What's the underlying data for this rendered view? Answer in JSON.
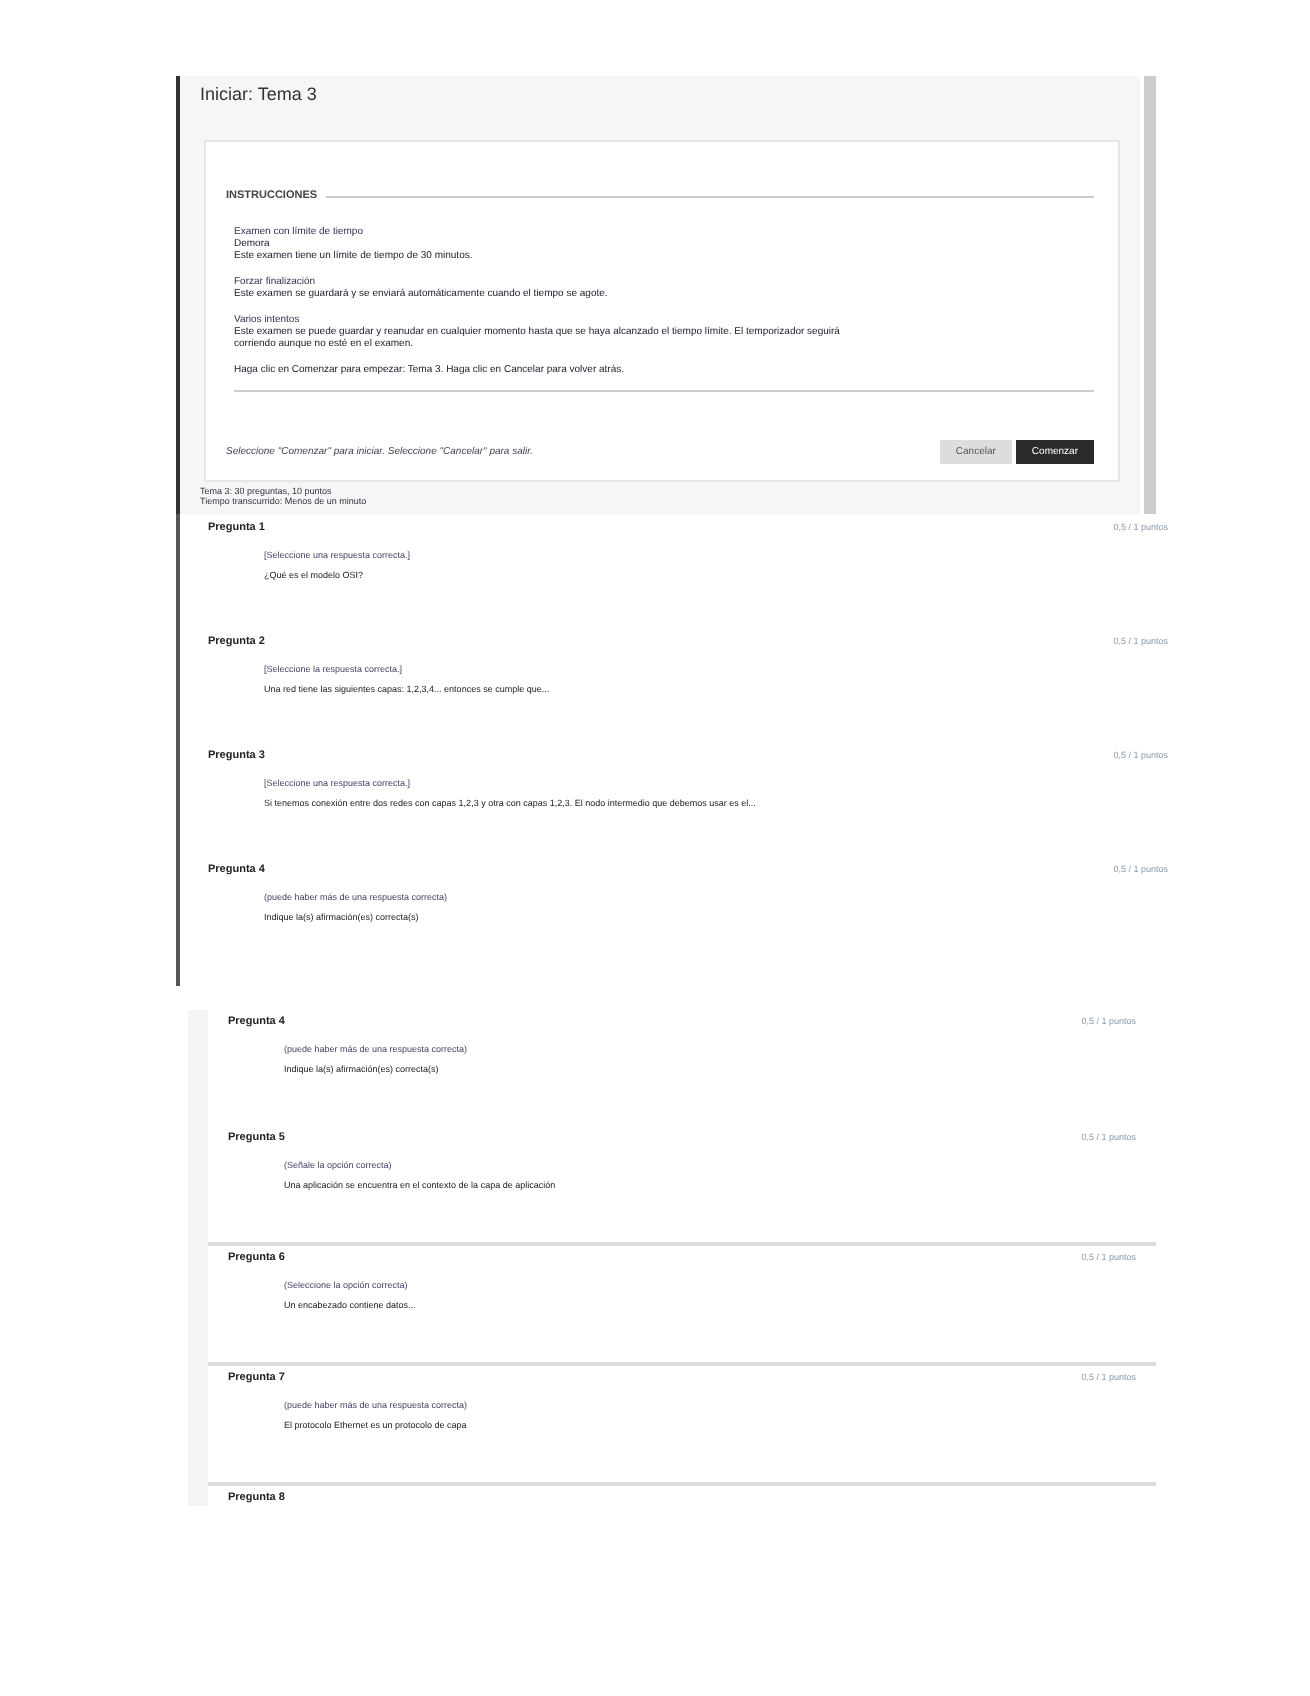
{
  "exam": {
    "title": "Iniciar: Tema 3",
    "section": "INSTRUCCIONES",
    "instructions": [
      {
        "heading": "Examen con límite de tiempo",
        "lines": [
          "Demora",
          "Este examen tiene un límite de tiempo de 30 minutos."
        ]
      },
      {
        "heading": "Forzar finalización",
        "lines": [
          "Este examen se guardará y se enviará automáticamente cuando el tiempo se agote."
        ]
      },
      {
        "heading": "Varios intentos",
        "lines": [
          "Este examen se puede guardar y reanudar en cualquier momento hasta que se haya alcanzado el tiempo límite. El temporizador seguirá",
          "corriendo aunque no esté en el examen."
        ]
      },
      {
        "lines": [
          "Haga clic en Comenzar para empezar: Tema 3. Haga clic en Cancelar para volver atrás."
        ]
      }
    ],
    "footer": "Seleccione \"Comenzar\" para iniciar. Seleccione \"Cancelar\" para salir.",
    "buttons": [
      {
        "label": "Cancelar",
        "kind": "secondary"
      },
      {
        "label": "Comenzar",
        "kind": "primary"
      }
    ],
    "status": [
      "Tema 3: 30 preguntas, 10 puntos",
      "Tiempo transcurrido: Menos de un minuto"
    ]
  },
  "questions": [
    {
      "title": "Pregunta 1",
      "points": "0,5 / 1 puntos",
      "hint": "[Seleccione una respuesta correcta.]",
      "text": "¿Qué es el modelo OSI?"
    },
    {
      "title": "Pregunta 2",
      "points": "0,5 / 1 puntos",
      "hint": "[Seleccione la respuesta correcta.]",
      "text": "Una red tiene las siguientes capas: 1,2,3,4... entonces se cumple que..."
    },
    {
      "title": "Pregunta 3",
      "points": "0,5 / 1 puntos",
      "hint": "[Seleccione una respuesta correcta.]",
      "text": "Si tenemos conexión entre dos redes con capas 1,2,3 y otra con capas 1,2,3. El nodo intermedio que debemos usar es el..."
    },
    {
      "title": "Pregunta 4",
      "points": "0,5 / 1 puntos",
      "hint": "(puede haber más de una respuesta correcta)",
      "text": "Indique la(s) afirmación(es) correcta(s)"
    }
  ],
  "questions_continued": [
    {
      "title": "Pregunta 4",
      "points": "0,5 / 1 puntos",
      "hint": "(puede haber más de una respuesta correcta)",
      "text": "Indique la(s) afirmación(es) correcta(s)",
      "divided": false
    },
    {
      "title": "Pregunta 5",
      "points": "0,5 / 1 puntos",
      "hint": "(Señale la opción correcta)",
      "text": "Una aplicación se encuentra en el contexto de la capa de aplicación",
      "divided": false
    },
    {
      "title": "Pregunta 6",
      "points": "0,5 / 1 puntos",
      "hint": "(Seleccione la opción correcta)",
      "text": "Un encabezado contiene datos...",
      "divided": true
    },
    {
      "title": "Pregunta 7",
      "points": "0,5 / 1 puntos",
      "hint": "(puede haber más de una respuesta correcta)",
      "text": "El protocolo Ethernet es un protocolo de capa",
      "divided": true
    },
    {
      "title": "Pregunta 8",
      "divided": true
    }
  ]
}
